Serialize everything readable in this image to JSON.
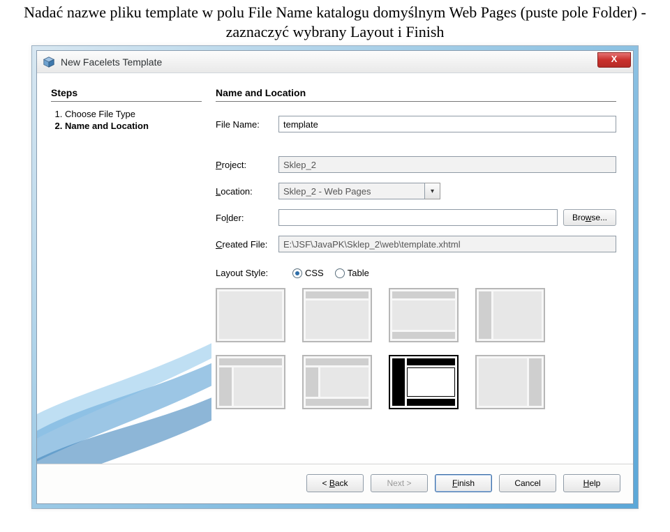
{
  "instruction": "Nadać nazwe pliku template w polu File Name katalogu domyślnym Web Pages (puste pole Folder) - zaznaczyć wybrany Layout i Finish",
  "dialog": {
    "title": "New Facelets Template",
    "close_symbol": "X",
    "steps": {
      "heading": "Steps",
      "items": [
        "Choose File Type",
        "Name and Location"
      ],
      "current_index": 1
    },
    "form": {
      "heading": "Name and Location",
      "labels": {
        "file_name": "File Name:",
        "project": "Project:",
        "location": "Location:",
        "folder": "Folder:",
        "created_file": "Created File:",
        "layout_style": "Layout Style:"
      },
      "values": {
        "file_name": "template",
        "project": "Sklep_2",
        "location": "Sklep_2 - Web Pages",
        "folder": "",
        "created_file": "E:\\JSF\\JavaPK\\Sklep_2\\web\\template.xhtml"
      },
      "browse": "Browse...",
      "layout_options": {
        "css": "CSS",
        "table": "Table",
        "selected": "css"
      }
    },
    "buttons": {
      "back": "< Back",
      "next": "Next >",
      "finish": "Finish",
      "cancel": "Cancel",
      "help": "Help"
    }
  }
}
